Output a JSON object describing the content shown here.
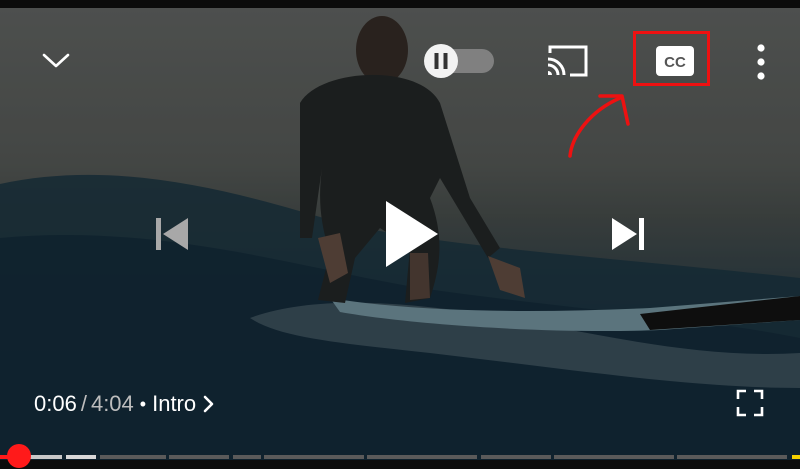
{
  "player": {
    "time_current": "0:06",
    "time_separator": "/",
    "time_total": "4:04",
    "dot_separator": "•",
    "chapter_title": "Intro",
    "progress_played_fraction": 0.025
  },
  "controls": {
    "collapse_icon": "chevron-down-icon",
    "autoplay_icon": "pause-toggle-icon",
    "autoplay_on": false,
    "cast_icon": "cast-icon",
    "captions_icon": "cc-icon",
    "captions_label": "CC",
    "more_icon": "more-vertical-icon",
    "previous_icon": "skip-previous-icon",
    "previous_enabled": false,
    "play_icon": "play-icon",
    "next_icon": "skip-next-icon",
    "fullscreen_icon": "fullscreen-icon"
  },
  "annotation": {
    "color": "#ee1111",
    "target": "captions-button"
  },
  "colors": {
    "progress_played": "#ff1a1a",
    "progress_buffered": "#c8c8c8",
    "progress_unplayed": "#5a5a5a",
    "progress_ad_marker": "#f5d100"
  }
}
